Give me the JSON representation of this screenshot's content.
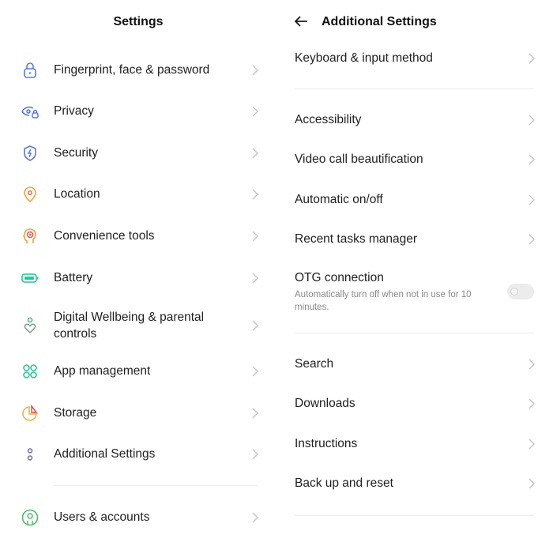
{
  "left": {
    "title": "Settings",
    "items": [
      {
        "label": "Fingerprint, face & password",
        "icon": "lock-icon"
      },
      {
        "label": "Privacy",
        "icon": "eye-lock-icon"
      },
      {
        "label": "Security",
        "icon": "shield-bolt-icon"
      },
      {
        "label": "Location",
        "icon": "location-pin-icon"
      },
      {
        "label": "Convenience tools",
        "icon": "head-target-icon"
      },
      {
        "label": "Battery",
        "icon": "battery-icon"
      },
      {
        "label": "Digital Wellbeing & parental",
        "label2": "controls",
        "icon": "person-heart-icon"
      },
      {
        "label": "App management",
        "icon": "app-grid-icon"
      },
      {
        "label": "Storage",
        "icon": "pie-chart-icon"
      },
      {
        "label": "Additional Settings",
        "icon": "more-dots-icon"
      },
      {
        "label": "Users & accounts",
        "icon": "user-circle-icon"
      }
    ]
  },
  "right": {
    "title": "Additional Settings",
    "back_icon": "back-arrow-icon",
    "items": [
      {
        "label": "Keyboard & input method"
      },
      {
        "label": "Accessibility"
      },
      {
        "label": "Video call beautification"
      },
      {
        "label": "Automatic on/off"
      },
      {
        "label": "Recent tasks manager"
      },
      {
        "label": "OTG connection",
        "sub1": "Automatically turn off when not in use for 10",
        "sub2": "minutes.",
        "toggle_on": false
      },
      {
        "label": "Search"
      },
      {
        "label": "Downloads"
      },
      {
        "label": "Instructions"
      },
      {
        "label": "Back up and reset"
      }
    ]
  }
}
